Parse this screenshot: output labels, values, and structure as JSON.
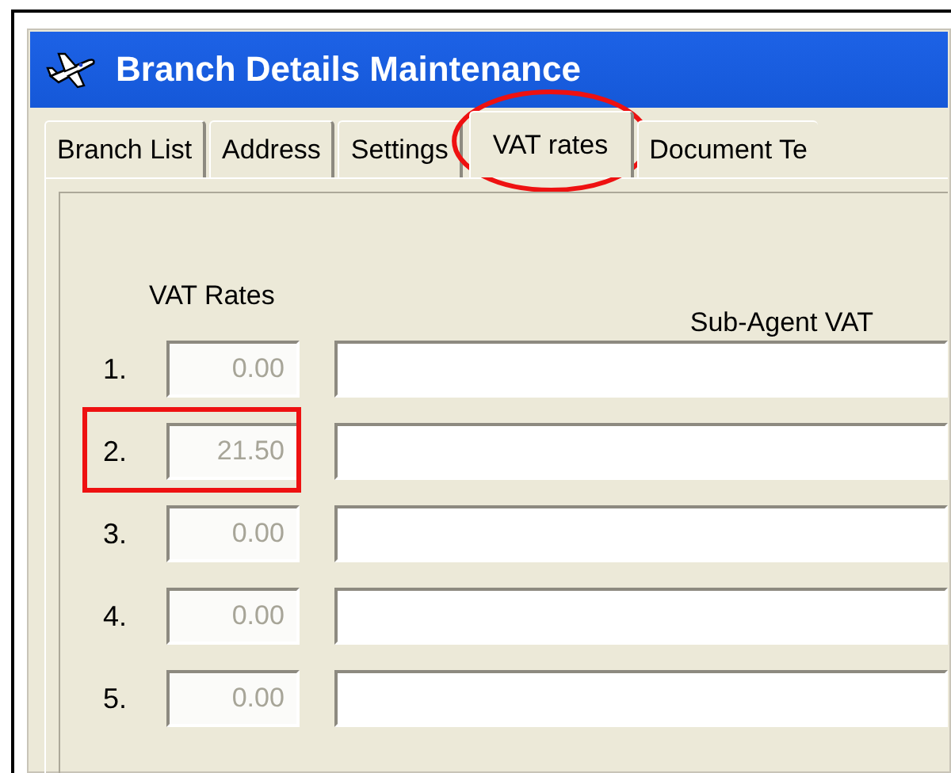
{
  "window": {
    "title": "Branch Details Maintenance"
  },
  "tabs": [
    {
      "label": "Branch List",
      "selected": false,
      "circled": false
    },
    {
      "label": "Address",
      "selected": false,
      "circled": false
    },
    {
      "label": "Settings",
      "selected": false,
      "circled": false
    },
    {
      "label": "VAT rates",
      "selected": true,
      "circled": true
    },
    {
      "label": "Document Te",
      "selected": false,
      "circled": false
    }
  ],
  "vat_rates_label": "VAT Rates",
  "sub_agent_label": "Sub-Agent VAT",
  "rows": [
    {
      "number": "1.",
      "rate": "0.00",
      "disabled": true,
      "boxed": false
    },
    {
      "number": "2.",
      "rate": "21.50",
      "disabled": true,
      "boxed": true
    },
    {
      "number": "3.",
      "rate": "0.00",
      "disabled": true,
      "boxed": false
    },
    {
      "number": "4.",
      "rate": "0.00",
      "disabled": true,
      "boxed": false
    },
    {
      "number": "5.",
      "rate": "0.00",
      "disabled": true,
      "boxed": false
    }
  ]
}
